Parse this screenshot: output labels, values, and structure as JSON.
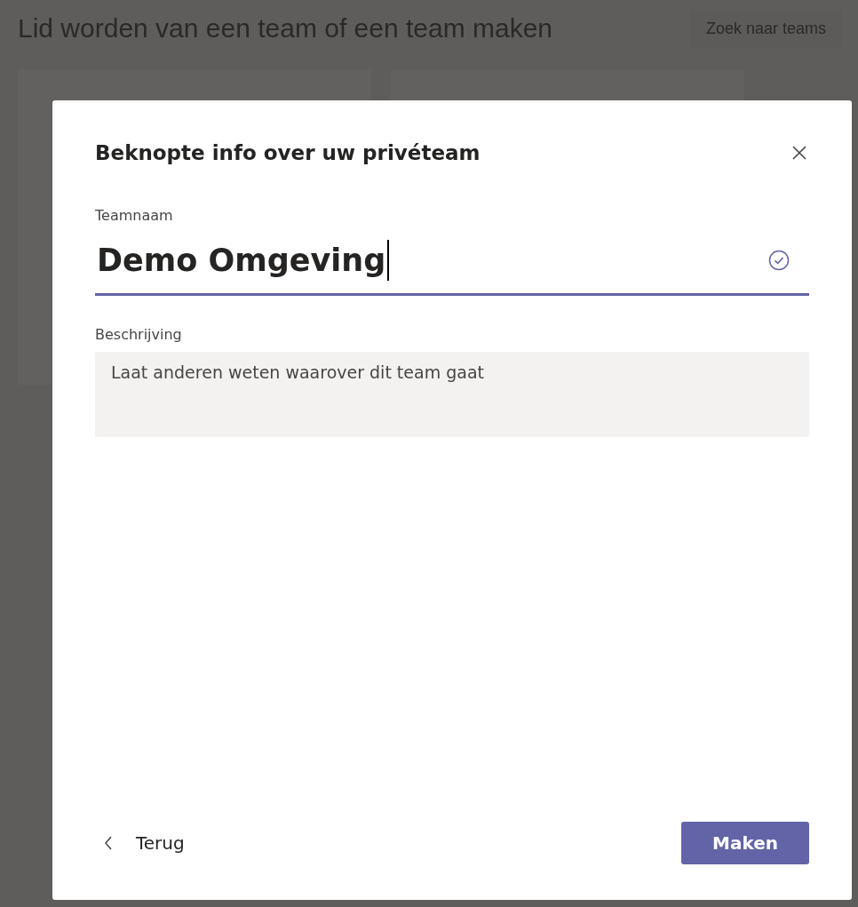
{
  "background": {
    "title": "Lid worden van een team of een team maken",
    "search_button": "Zoek naar teams"
  },
  "dialog": {
    "title": "Beknopte info over uw privéteam",
    "name_field": {
      "label": "Teamnaam",
      "value": "Demo Omgeving",
      "valid": true
    },
    "description_field": {
      "label": "Beschrijving",
      "placeholder": "Laat anderen weten waarover dit team gaat"
    },
    "back_button": "Terug",
    "create_button": "Maken"
  }
}
